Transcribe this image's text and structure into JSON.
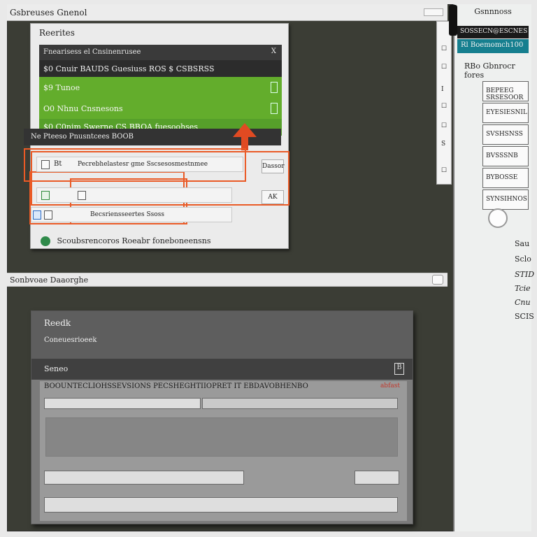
{
  "titlebar": {
    "title": "Gsbreuses Gnenol"
  },
  "dialog1": {
    "header": "Reerites",
    "list_header": "Fnearisess el Cnsinenrusee",
    "list_header_btn": "X",
    "rows": [
      {
        "label": "$0 Cnuir BAUDS Guesiuss ROS  $ CSBSRSS"
      },
      {
        "label": "$9 Tunoe"
      },
      {
        "label": "O0 Nhnu Cnsnesons"
      },
      {
        "label": "$0 C0nim Swerne CS BBOA fuesoohses"
      }
    ],
    "section_label": "Ne Pteeso Pnusntcees BOOB",
    "form_rows": [
      {
        "prefix": "Bt",
        "text": "Pecrebhelastesr gme Sscsesosmestnmee"
      },
      {
        "prefix": "",
        "text": ""
      },
      {
        "prefix": "",
        "text": "Becsriensseertes Ssoss"
      }
    ],
    "side_btns": [
      "Dassor",
      "AK"
    ],
    "status": "Scoubsrencoros Roeabr foneboneensns"
  },
  "midbar": {
    "title": "Sonbvoae Daaorghe"
  },
  "dialog2": {
    "title": "Reedk",
    "subtitle": "Coneuesrioeek",
    "band_label": "Seneo",
    "band_icon": "B",
    "body_header": "BOOUNTECLIOHSSEVSIONS PECSHEGHTIIOPRET IT EBDAVOBHENBO",
    "body_tag": "abfast"
  },
  "rpanel": {
    "caption": "Gsnnnoss",
    "dark_label": "SOSSECN@ESCNES",
    "teal_label": "Rl Boemomch100",
    "sub_label": "RBo Gbnrocr fores",
    "cells": [
      "BEPEEG SRSESOOR",
      "EYESIESNIL",
      "SVSHSNSS",
      "BVSSSNB",
      "BYBOSSE",
      "SYNSIHNOS"
    ],
    "labels": [
      "Sau",
      "Sclo",
      "STID",
      "Tcie",
      "Cnu",
      "SCIS"
    ]
  },
  "strip": {
    "glyphs": [
      "☐",
      "☐",
      "I",
      "☐",
      "☐",
      "S",
      "☐"
    ]
  },
  "colors": {
    "accent": "#ea5a26",
    "green": "#63ad2c",
    "teal": "#167f8f"
  }
}
